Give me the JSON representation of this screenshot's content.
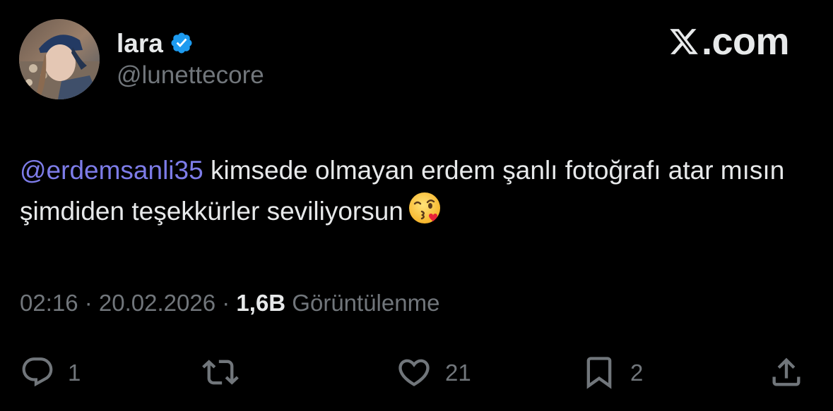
{
  "author": {
    "display_name": "lara",
    "handle": "@lunettecore",
    "verified_icon": "verified-badge-icon",
    "avatar_icon": "profile-photo"
  },
  "brand": {
    "label": "X.com",
    "logo_icon": "x-logo-icon"
  },
  "tweet": {
    "mention": "@erdemsanli35",
    "text": " kimsede olmayan erdem şanlı fotoğrafı atar mısın şimdiden teşekkürler seviliyorsun",
    "emoji": "face-blowing-a-kiss-emoji"
  },
  "meta": {
    "time": "02:16",
    "separator": " · ",
    "date": "20.02.2026",
    "views_count": "1,6B",
    "views_label": " Görüntülenme"
  },
  "actions": {
    "reply_count": "1",
    "retweet_count": "",
    "like_count": "21",
    "bookmark_count": "2"
  },
  "colors": {
    "background": "#000000",
    "text_primary": "#e7e9ea",
    "text_secondary": "#71767b",
    "mention": "#7d7ce8",
    "verified": "#1d9bf0"
  }
}
